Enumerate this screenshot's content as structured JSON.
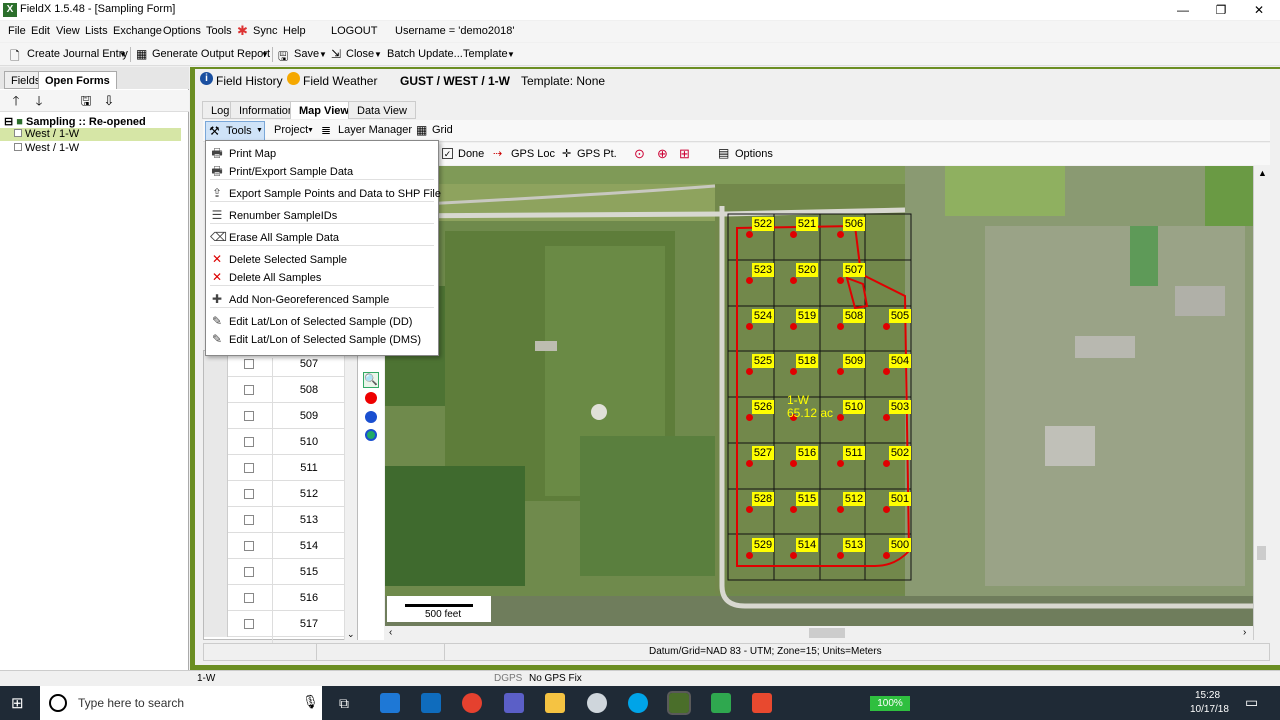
{
  "window": {
    "title": "FieldX 1.5.48 - [Sampling Form]",
    "minimize": "—",
    "maximize": "❐",
    "close": "✕"
  },
  "menu": {
    "items": [
      "File",
      "Edit",
      "View",
      "Lists",
      "Exchange",
      "Options",
      "Tools",
      "Sync",
      "Help"
    ],
    "logout": "LOGOUT",
    "username": "Username = 'demo2018'"
  },
  "toolbar": {
    "create_journal": "Create Journal Entry",
    "generate_report": "Generate Output Report",
    "save": "Save",
    "close": "Close",
    "batch_update": "Batch Update...",
    "template": "Template"
  },
  "left_panel": {
    "tabs": [
      "Fields",
      "Open Forms"
    ],
    "tree_root": "Sampling :: Re-opened Forms...",
    "tree_items": [
      "West / 1-W",
      "West / 1-W"
    ]
  },
  "field_bar": {
    "history": "Field History",
    "weather": "Field Weather",
    "field": "GUST / WEST / 1-W",
    "template": "Template: None"
  },
  "view_tabs": [
    "Log",
    "Information",
    "Map View",
    "Data View"
  ],
  "map_toolbar": {
    "tools": "Tools",
    "project": "Project",
    "layer_manager": "Layer Manager",
    "grid": "Grid",
    "done": "Done",
    "gps_loc": "GPS Loc",
    "gps_pt": "GPS Pt.",
    "options": "Options"
  },
  "dropdown": {
    "items": [
      {
        "label": "Print Map",
        "icon": "printer-icon"
      },
      {
        "label": "Print/Export Sample Data",
        "icon": "printer-icon"
      },
      {
        "label": "Export Sample Points and Data to SHP File",
        "icon": "export-icon"
      },
      {
        "label": "Renumber SampleIDs",
        "icon": "list-icon"
      },
      {
        "label": "Erase All Sample Data",
        "icon": "eraser-icon"
      },
      {
        "label": "Delete Selected Sample",
        "icon": "red-x-icon"
      },
      {
        "label": "Delete All Samples",
        "icon": "red-x-icon"
      },
      {
        "label": "Add Non-Georeferenced Sample",
        "icon": "plus-icon"
      },
      {
        "label": "Edit Lat/Lon of Selected Sample (DD)",
        "icon": "edit-icon"
      },
      {
        "label": "Edit Lat/Lon of Selected Sample (DMS)",
        "icon": "edit-icon"
      }
    ]
  },
  "sample_list": [
    "507",
    "508",
    "509",
    "510",
    "511",
    "512",
    "513",
    "514",
    "515",
    "516",
    "517"
  ],
  "map": {
    "field_label": "1-W",
    "acres": "65.12 ac",
    "scale": "500 feet",
    "samples": [
      [
        "522",
        "521",
        "506"
      ],
      [
        "523",
        "520",
        "507"
      ],
      [
        "524",
        "519",
        "508",
        "505"
      ],
      [
        "525",
        "518",
        "509",
        "504"
      ],
      [
        "526",
        "",
        "510",
        "503"
      ],
      [
        "527",
        "516",
        "511",
        "502"
      ],
      [
        "528",
        "515",
        "512",
        "501"
      ],
      [
        "529",
        "514",
        "513",
        "500"
      ]
    ]
  },
  "status": {
    "datum": "Datum/Grid=NAD 83 - UTM; Zone=15; Units=Meters",
    "field": "1-W",
    "dgps": "DGPS",
    "gps_fix": "No GPS Fix"
  },
  "taskbar": {
    "search": "Type here to search",
    "battery": "100%",
    "time": "15:28",
    "date": "10/17/18"
  },
  "colors": {
    "sample_label": "#ffff00",
    "sample_dot": "#e00000",
    "frame_green": "#6b8e23"
  }
}
